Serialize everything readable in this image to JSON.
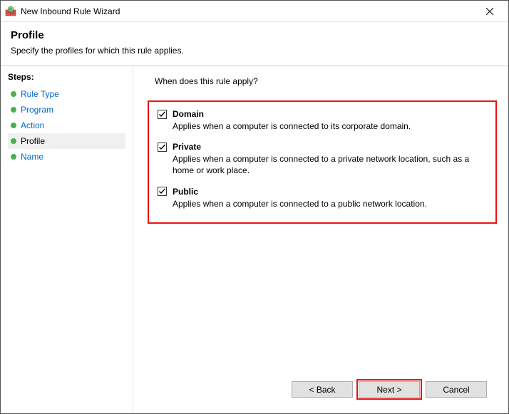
{
  "window": {
    "title": "New Inbound Rule Wizard"
  },
  "header": {
    "title": "Profile",
    "subtitle": "Specify the profiles for which this rule applies."
  },
  "sidebar": {
    "heading": "Steps:",
    "items": [
      {
        "label": "Rule Type"
      },
      {
        "label": "Program"
      },
      {
        "label": "Action"
      },
      {
        "label": "Profile"
      },
      {
        "label": "Name"
      }
    ],
    "current_index": 3
  },
  "content": {
    "prompt": "When does this rule apply?",
    "options": [
      {
        "label": "Domain",
        "checked": true,
        "desc": "Applies when a computer is connected to its corporate domain."
      },
      {
        "label": "Private",
        "checked": true,
        "desc": "Applies when a computer is connected to a private network location, such as a home or work place."
      },
      {
        "label": "Public",
        "checked": true,
        "desc": "Applies when a computer is connected to a public network location."
      }
    ]
  },
  "buttons": {
    "back": "< Back",
    "next": "Next >",
    "cancel": "Cancel"
  }
}
